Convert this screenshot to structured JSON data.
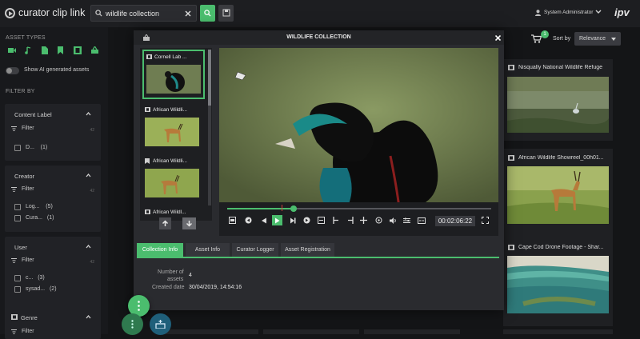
{
  "app": {
    "name": "curator clip link",
    "brand": "ipv"
  },
  "colors": {
    "accent": "#4bbd6e",
    "background": "#141517",
    "panel": "#212226",
    "modal": "#2a2b2f"
  },
  "search": {
    "value": "wildlife collection",
    "clear_icon": "close-icon",
    "search_icon": "search-icon",
    "save_icon": "save-search-icon"
  },
  "header": {
    "user": "System Administrator",
    "user_icon": "user-icon",
    "menu_icon": "chevron-down-icon"
  },
  "sidebar": {
    "asset_types_label": "ASSET TYPES",
    "asset_type_icons": [
      "video-icon",
      "audio-icon",
      "document-icon",
      "bookmark-icon",
      "film-icon",
      "collection-icon"
    ],
    "ai_toggle_label": "Show AI generated assets",
    "filter_by_label": "FILTER BY",
    "panels": [
      {
        "title": "Content Label",
        "filter_label": "Filter",
        "count": "42",
        "options": [
          {
            "label": "D...",
            "count": "(1)"
          }
        ]
      },
      {
        "title": "Creator",
        "filter_label": "Filter",
        "count": "42",
        "options": [
          {
            "label": "Log...",
            "count": "(5)"
          },
          {
            "label": "Cura...",
            "count": "(1)"
          }
        ]
      },
      {
        "title": "User",
        "filter_label": "Filter",
        "count": "42",
        "options": [
          {
            "label": "c...",
            "count": "(3)"
          },
          {
            "label": "sysad...",
            "count": "(2)"
          }
        ]
      },
      {
        "title": "Genre",
        "filter_label": "Filter"
      }
    ]
  },
  "results": {
    "cart_count": "1",
    "sort_label": "Sort by",
    "sort_value": "Relevance",
    "cards": [
      {
        "title": "Nisqually National Wildlife Refuge"
      },
      {
        "title": "African Wildlife Showreel_00h01..."
      },
      {
        "title": "Cape Cod Drone Footage - Shar..."
      }
    ]
  },
  "modal": {
    "title": "WILDLIFE COLLECTION",
    "close_icon": "close-icon",
    "clips": [
      {
        "title": "Cornell Lab ...",
        "selected": true
      },
      {
        "title": "African Wildli...",
        "selected": false
      },
      {
        "title": "African Wildli...",
        "selected": false
      },
      {
        "title": "African Wildl...",
        "selected": false
      }
    ],
    "player": {
      "timecode": "00:02:06:22",
      "progress": 0.25
    },
    "tabs": [
      {
        "label": "Collection Info",
        "active": true
      },
      {
        "label": "Asset Info",
        "active": false
      },
      {
        "label": "Curator Logger",
        "active": false
      },
      {
        "label": "Asset Registration",
        "active": false
      }
    ],
    "info": {
      "number_label_1": "Number of",
      "number_label_2": "assets",
      "number_value": "4",
      "created_label": "Created date",
      "created_value": "30/04/2019, 14:54:16"
    }
  }
}
